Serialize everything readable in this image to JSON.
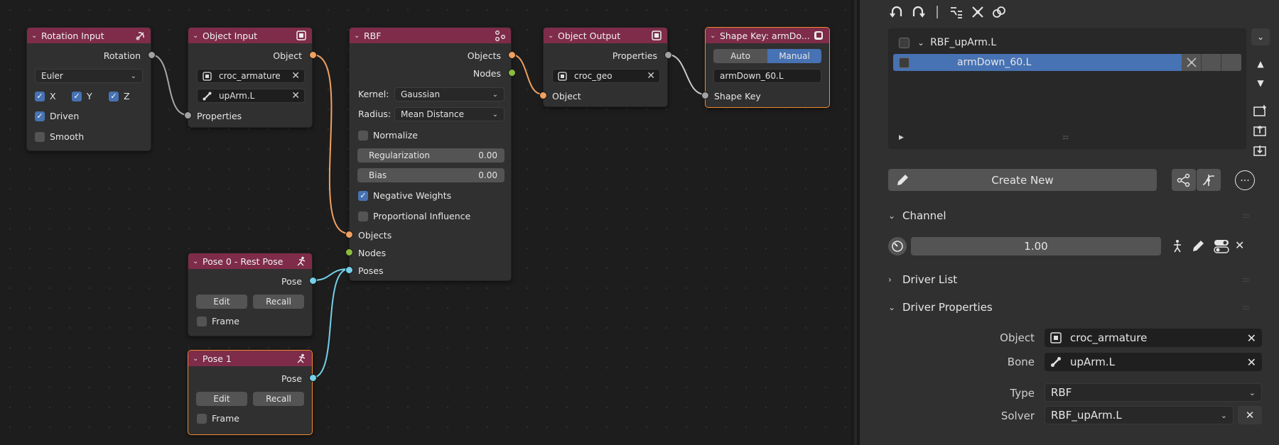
{
  "nodes": {
    "rotation_input": {
      "title": "Rotation Input",
      "output_rotation": "Rotation",
      "mode": "Euler",
      "axis_x": "X",
      "axis_y": "Y",
      "axis_z": "Z",
      "driven": "Driven",
      "smooth": "Smooth"
    },
    "object_input": {
      "title": "Object Input",
      "output_object": "Object",
      "object_value": "croc_armature",
      "bone_value": "upArm.L",
      "input_properties": "Properties"
    },
    "rbf": {
      "title": "RBF",
      "output_objects": "Objects",
      "output_nodes": "Nodes",
      "kernel_label": "Kernel:",
      "kernel_value": "Gaussian",
      "radius_label": "Radius:",
      "radius_value": "Mean Distance",
      "normalize": "Normalize",
      "regularization_label": "Regularization",
      "regularization_value": "0.00",
      "bias_label": "Bias",
      "bias_value": "0.00",
      "negative_weights": "Negative Weights",
      "proportional_influence": "Proportional Influence",
      "input_objects": "Objects",
      "input_nodes": "Nodes",
      "input_poses": "Poses"
    },
    "object_output": {
      "title": "Object Output",
      "output_properties": "Properties",
      "object_value": "croc_geo",
      "input_object": "Object"
    },
    "shape_key": {
      "title": "Shape Key: armDo...",
      "auto": "Auto",
      "manual": "Manual",
      "key_value": "armDown_60.L",
      "input_shape_key": "Shape Key"
    },
    "pose0": {
      "title": "Pose 0 - Rest Pose",
      "output_pose": "Pose",
      "edit": "Edit",
      "recall": "Recall",
      "frame": "Frame"
    },
    "pose1": {
      "title": "Pose 1",
      "output_pose": "Pose",
      "edit": "Edit",
      "recall": "Recall",
      "frame": "Frame"
    }
  },
  "panel": {
    "list": {
      "parent": "RBF_upArm.L",
      "child": "armDown_60.L"
    },
    "create_new": "Create New",
    "channel": {
      "title": "Channel",
      "value": "1.00"
    },
    "driver_list": {
      "title": "Driver List"
    },
    "driver_properties": {
      "title": "Driver Properties",
      "object_label": "Object",
      "object_value": "croc_armature",
      "bone_label": "Bone",
      "bone_value": "upArm.L",
      "type_label": "Type",
      "type_value": "RBF",
      "solver_label": "Solver",
      "solver_value": "RBF_upArm.L"
    }
  },
  "colors": {
    "node_header": "#7e2c49",
    "selection_accent": "#4772b3",
    "active_outline": "#f08a30",
    "socket_orange": "#f0a060",
    "socket_green": "#8cbc3c",
    "socket_cyan": "#74d0e8",
    "socket_gray": "#a1a1a1"
  }
}
